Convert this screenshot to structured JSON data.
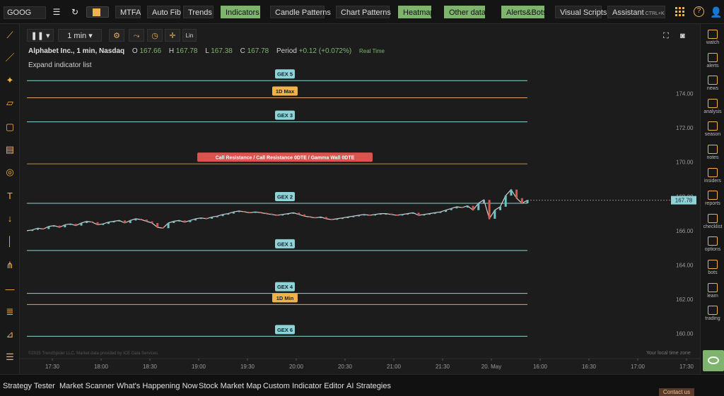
{
  "toolbar": {
    "symbol": "GOOG",
    "buttons": [
      {
        "label": "MTFA",
        "on": false
      },
      {
        "label": "Auto Fib",
        "on": false
      },
      {
        "label": "Trends",
        "on": false
      },
      {
        "label": "Indicators",
        "on": true
      },
      {
        "label": "Candle Patterns",
        "on": false
      },
      {
        "label": "Chart Patterns",
        "on": false
      },
      {
        "label": "Heatmap",
        "on": true
      },
      {
        "label": "Other data",
        "on": true
      },
      {
        "label": "Alerts&Bots",
        "on": true
      },
      {
        "label": "Visual Scripts",
        "on": false
      },
      {
        "label": "Assistant",
        "on": false
      }
    ],
    "assistant_shortcut": "CTRL+K",
    "help_glyph": "?"
  },
  "chart_toolbar": {
    "interval": "1 min",
    "interval_chevron": "▾",
    "pause_glyph": "❚❚",
    "log_label": "Lin"
  },
  "chart_header": {
    "title": "Alphabet Inc., 1 min, Nasdaq",
    "open_label": "O",
    "open": "167.66",
    "high_label": "H",
    "high": "167.78",
    "low_label": "L",
    "low": "167.38",
    "close_label": "C",
    "close": "167.78",
    "period_label": "Period",
    "period_change": "+0.12 (+0.072%)",
    "realtime": "Real Time",
    "expand": "Expand indicator list"
  },
  "chart_data": {
    "type": "line",
    "ylim": [
      159.0,
      176.2
    ],
    "x_ticks": [
      "17:30",
      "18:00",
      "18:30",
      "19:00",
      "19:30",
      "20:00",
      "20:30",
      "21:00",
      "21:30",
      "20. May",
      "16:00",
      "16:30",
      "17:00",
      "17:30"
    ],
    "y_ticks": [
      160,
      162,
      164,
      166,
      168,
      170,
      172,
      174
    ],
    "y_tick_labels": [
      "160.00",
      "162.00",
      "164.00",
      "166.00",
      "168.00",
      "170.00",
      "172.00",
      "174.00"
    ],
    "last_price": 167.78,
    "last_price_label": "167.78",
    "levels": [
      {
        "name": "GEX 5",
        "price": 174.75,
        "color": "#8fd3d6",
        "label_bg": "#8fd3d6"
      },
      {
        "name": "1D Max",
        "price": 173.75,
        "color": "#e0a35a",
        "label_bg": "#f0b24a"
      },
      {
        "name": "GEX 3",
        "price": 172.35,
        "color": "#8fd3d6",
        "label_bg": "#8fd3d6"
      },
      {
        "name": "Call Resistance / Call Resistance 0DTE / Gamma Wall 0DTE",
        "price": 169.9,
        "color": "#b88a55",
        "label_bg": "#d9534f"
      },
      {
        "name": "GEX 2",
        "price": 167.6,
        "color": "#8fd3d6",
        "label_bg": "#8fd3d6"
      },
      {
        "name": "GEX 1",
        "price": 164.85,
        "color": "#8fd3d6",
        "label_bg": "#8fd3d6"
      },
      {
        "name": "GEX 4",
        "price": 162.35,
        "color": "#8fd3d6",
        "label_bg": "#8fd3d6"
      },
      {
        "name": "1D Min",
        "price": 161.7,
        "color": "#e0a35a",
        "label_bg": "#f0b24a"
      },
      {
        "name": "GEX 6",
        "price": 159.85,
        "color": "#8fd3d6",
        "label_bg": "#8fd3d6"
      }
    ],
    "series": [
      {
        "values": [
          166.0,
          166.05,
          166.15,
          166.1,
          166.25,
          166.3,
          166.2,
          166.35,
          166.4,
          166.3,
          166.45,
          166.55,
          166.5,
          166.35,
          166.4,
          166.5,
          166.55,
          166.6,
          166.45,
          166.6,
          166.7,
          166.65,
          166.55,
          166.45,
          166.2,
          166.15,
          166.45,
          166.55,
          166.6,
          166.5,
          166.6,
          166.7,
          166.75,
          166.7,
          166.8,
          166.85,
          166.95,
          167.0,
          167.1,
          167.15,
          167.1,
          167.05,
          167.1,
          167.05,
          167.0,
          166.95,
          166.9,
          166.95,
          167.0,
          167.05,
          166.95,
          166.85,
          166.8,
          166.75,
          166.8,
          166.7,
          166.65,
          166.7,
          166.75,
          166.8,
          166.85,
          166.9,
          166.95,
          166.9,
          166.95,
          167.0,
          167.0,
          166.95,
          166.9,
          166.95,
          167.0,
          167.05,
          166.9,
          166.95,
          167.0,
          167.05,
          167.1,
          167.2,
          167.3,
          167.4,
          167.35,
          167.45,
          167.2,
          167.6,
          167.8,
          166.7,
          167.2,
          167.4,
          168.05,
          168.4,
          167.9,
          167.6,
          167.78
        ]
      }
    ]
  },
  "copyright": "©2025 TrendSpider LLC. Market data provided by ICE Data Services.",
  "timezone": "Your local time zone",
  "right_sidebar": [
    {
      "label": "watch"
    },
    {
      "label": "alerts"
    },
    {
      "label": "news"
    },
    {
      "label": "analysis"
    },
    {
      "label": "season"
    },
    {
      "label": "notes"
    },
    {
      "label": "insiders"
    },
    {
      "label": "reports"
    },
    {
      "label": "checklist"
    },
    {
      "label": "options"
    },
    {
      "label": "bots"
    },
    {
      "label": "learn"
    },
    {
      "label": "trading"
    }
  ],
  "bottom_bar": [
    {
      "label": "Strategy Tester"
    },
    {
      "label": "Market Scanner"
    },
    {
      "label": "What's Happening Now"
    },
    {
      "label": "Stock Market Map"
    },
    {
      "label": "Custom Indicator Editor"
    },
    {
      "label": "AI Strategies"
    }
  ],
  "contact_label": "Contact us",
  "colors": {
    "accent": "#f0b24a",
    "active": "#7fb46f",
    "gex": "#8fd3d6",
    "resistance": "#d9534f"
  }
}
